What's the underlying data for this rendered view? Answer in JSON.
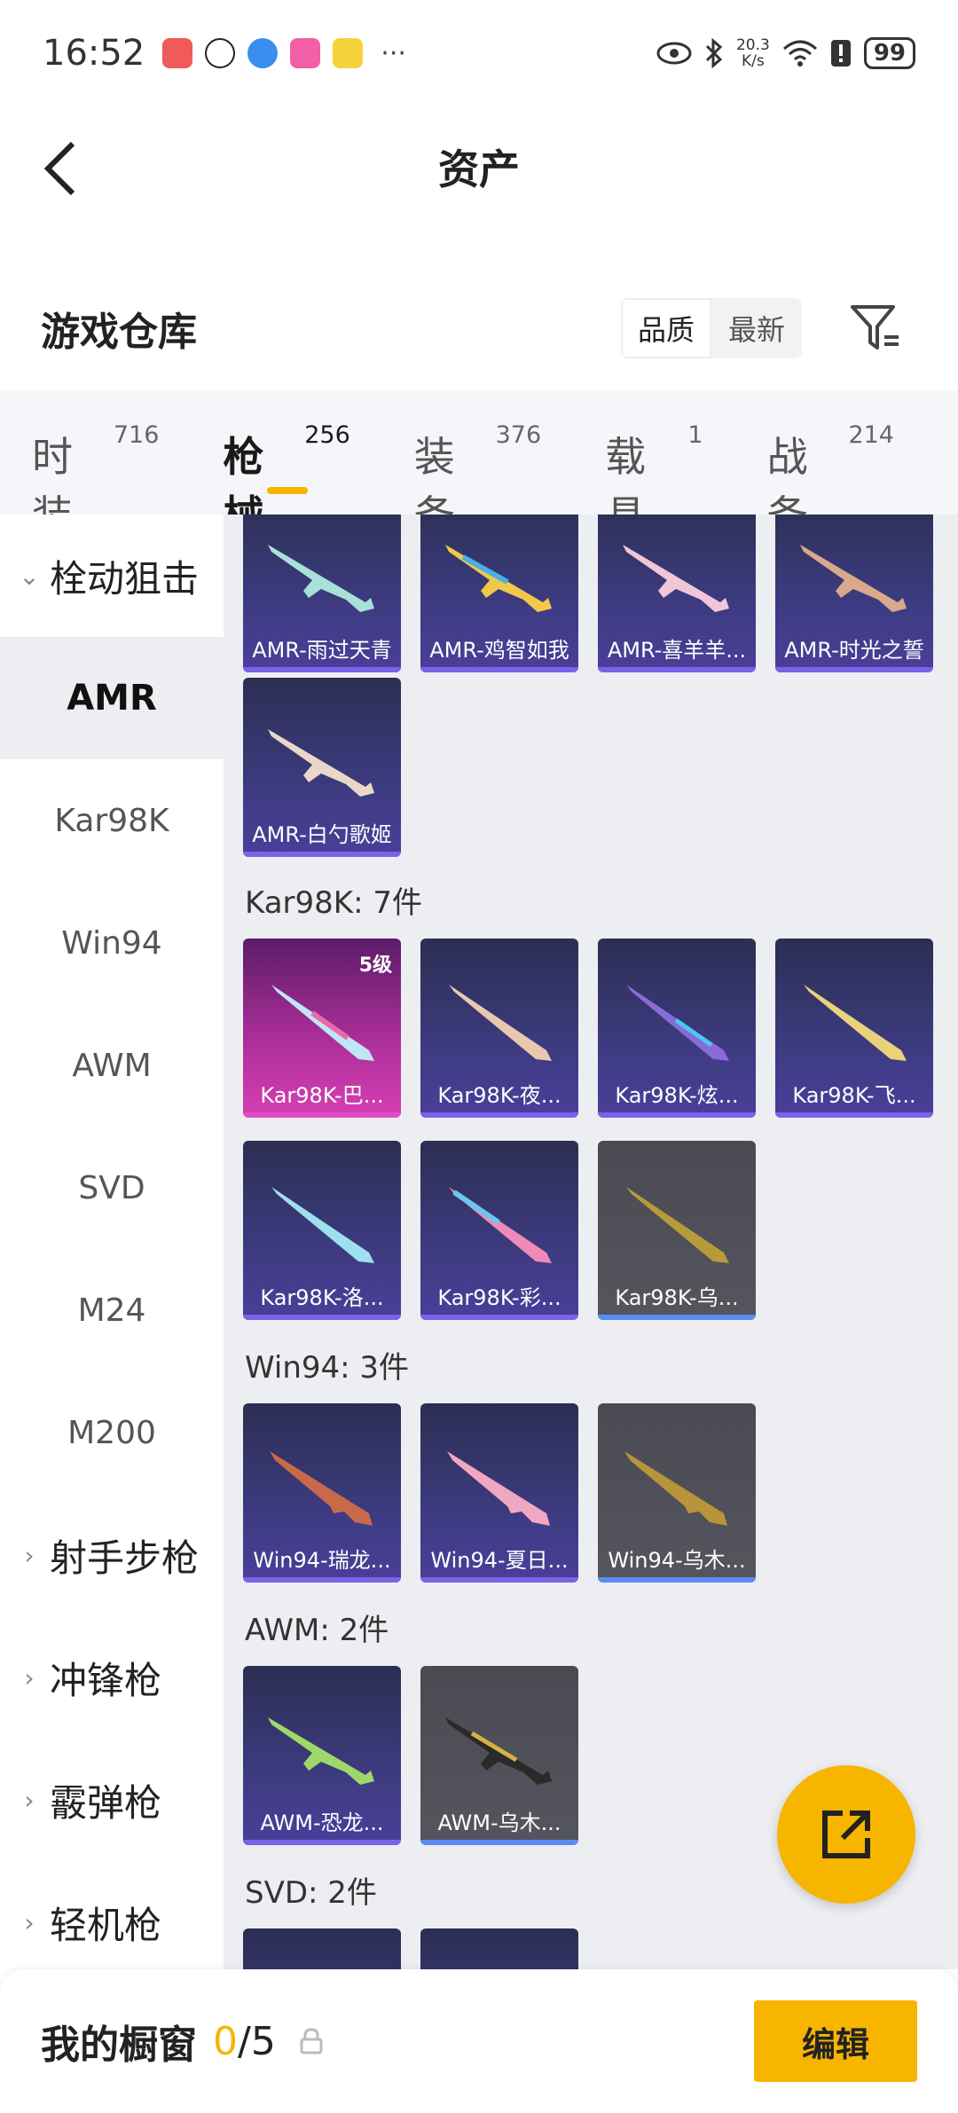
{
  "status_bar": {
    "time": "16:52",
    "net_speed_value": "20.3",
    "net_speed_unit": "K/s",
    "battery": "99",
    "more": "···"
  },
  "header": {
    "title": "资产"
  },
  "warehouse": {
    "title": "游戏仓库",
    "sort_options": [
      "品质",
      "最新"
    ],
    "active_sort": "品质"
  },
  "tabs": [
    {
      "label": "时装",
      "count": "716"
    },
    {
      "label": "枪械",
      "count": "256"
    },
    {
      "label": "装备",
      "count": "376"
    },
    {
      "label": "载具",
      "count": "1"
    },
    {
      "label": "战备",
      "count": "214"
    }
  ],
  "active_tab": "枪械",
  "sidebar": {
    "group_sniper": "栓动狙击",
    "items": [
      "AMR",
      "Kar98K",
      "Win94",
      "AWM",
      "SVD",
      "M24",
      "M200"
    ],
    "active_item": "AMR",
    "groups_collapsed": [
      "射手步枪",
      "冲锋枪",
      "霰弹枪",
      "轻机枪"
    ]
  },
  "sections": [
    {
      "title": "",
      "items": [
        {
          "name": "AMR-雨过天青"
        },
        {
          "name": "AMR-鸡智如我"
        },
        {
          "name": "AMR-喜羊羊..."
        },
        {
          "name": "AMR-时光之誓"
        },
        {
          "name": "AMR-白勺歌姬"
        }
      ]
    },
    {
      "title": "Kar98K: 7件",
      "items": [
        {
          "name": "Kar98K-巴...",
          "level": "5级"
        },
        {
          "name": "Kar98K-夜..."
        },
        {
          "name": "Kar98K-炫..."
        },
        {
          "name": "Kar98K-飞..."
        },
        {
          "name": "Kar98K-洛..."
        },
        {
          "name": "Kar98K-彩..."
        },
        {
          "name": "Kar98K-乌..."
        }
      ]
    },
    {
      "title": "Win94: 3件",
      "items": [
        {
          "name": "Win94-瑞龙..."
        },
        {
          "name": "Win94-夏日..."
        },
        {
          "name": "Win94-乌木..."
        }
      ]
    },
    {
      "title": "AWM: 2件",
      "items": [
        {
          "name": "AWM-恐龙..."
        },
        {
          "name": "AWM-乌木..."
        }
      ]
    },
    {
      "title": "SVD: 2件",
      "items": []
    }
  ],
  "bottom": {
    "showcase_label": "我的橱窗",
    "current": "0",
    "total": "/5",
    "edit": "编辑"
  },
  "colors": {
    "accent": "#f7b500",
    "card_purple": "#3b3a7c",
    "card_pink": "#d53fb3",
    "card_gray": "#55555e"
  }
}
